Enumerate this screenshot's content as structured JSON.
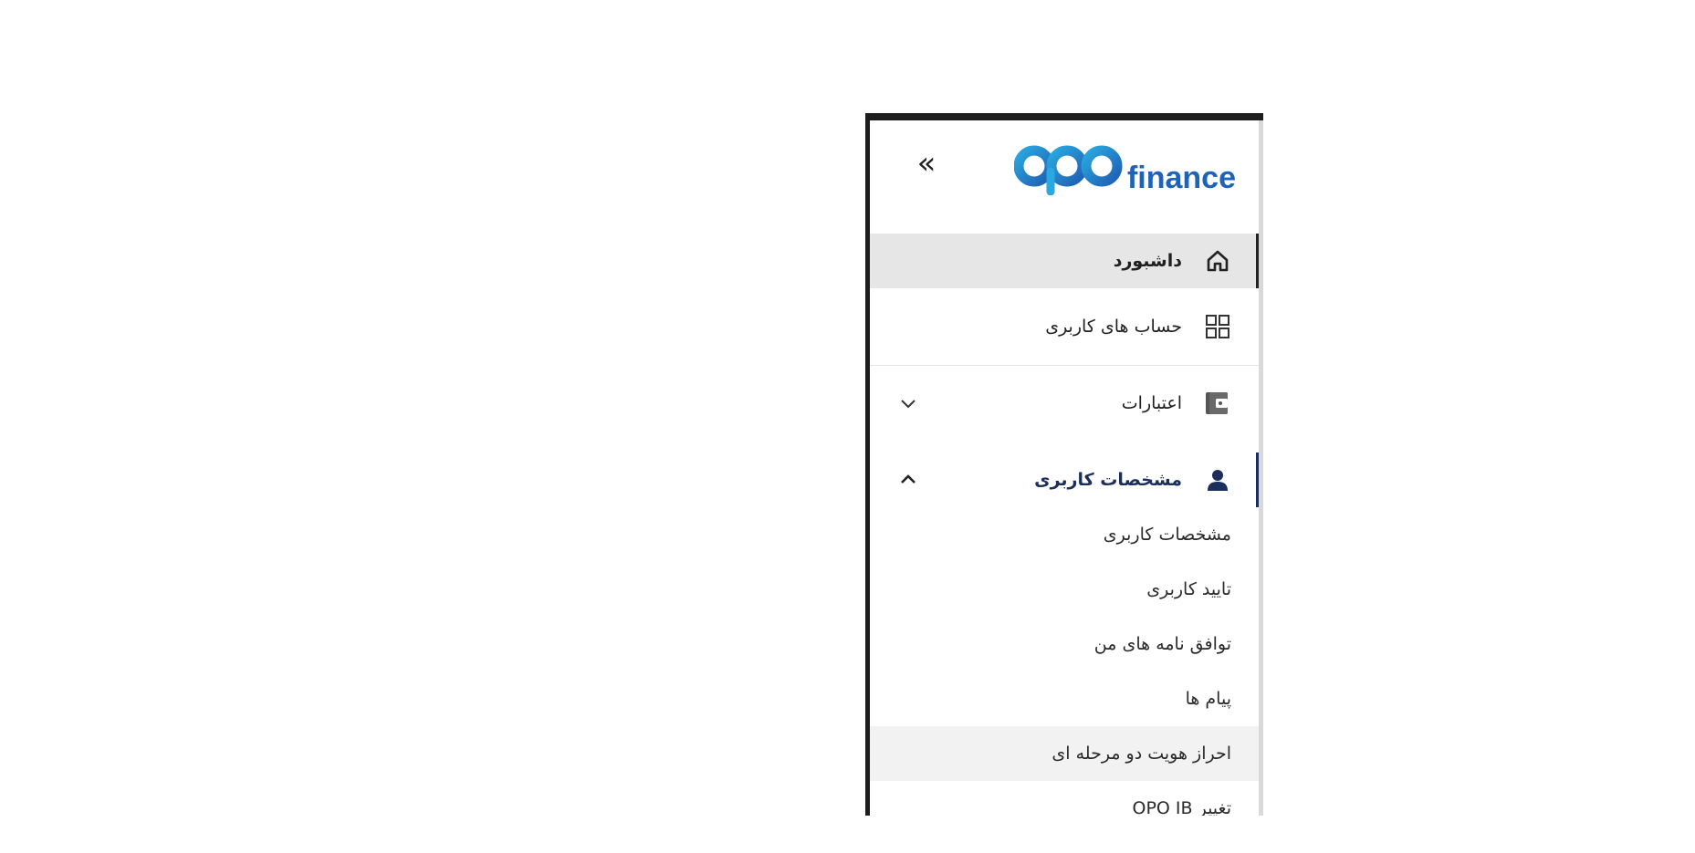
{
  "sidebar": {
    "logo": {
      "text": "finance",
      "alt": "OPO"
    },
    "items": [
      {
        "label": "داشبورد",
        "icon": "home-icon"
      },
      {
        "label": "حساب های کاربری",
        "icon": "grid-icon"
      },
      {
        "label": "اعتبارات",
        "icon": "wallet-icon"
      },
      {
        "label": "مشخصات کاربری",
        "icon": "user-icon"
      }
    ],
    "submenu": [
      {
        "label": "مشخصات کاربری"
      },
      {
        "label": "تایید کاربری"
      },
      {
        "label": "توافق نامه های من"
      },
      {
        "label": "پیام ها"
      },
      {
        "label": "احراز هویت دو مرحله ای"
      },
      {
        "label": "تغییر OPO IB"
      }
    ],
    "collapse_icon": "double-chevron-left-icon",
    "colors": {
      "brand": "#1f63b8",
      "brand_light": "#2aa8e0",
      "active_bar": "#1b2e5c"
    }
  }
}
